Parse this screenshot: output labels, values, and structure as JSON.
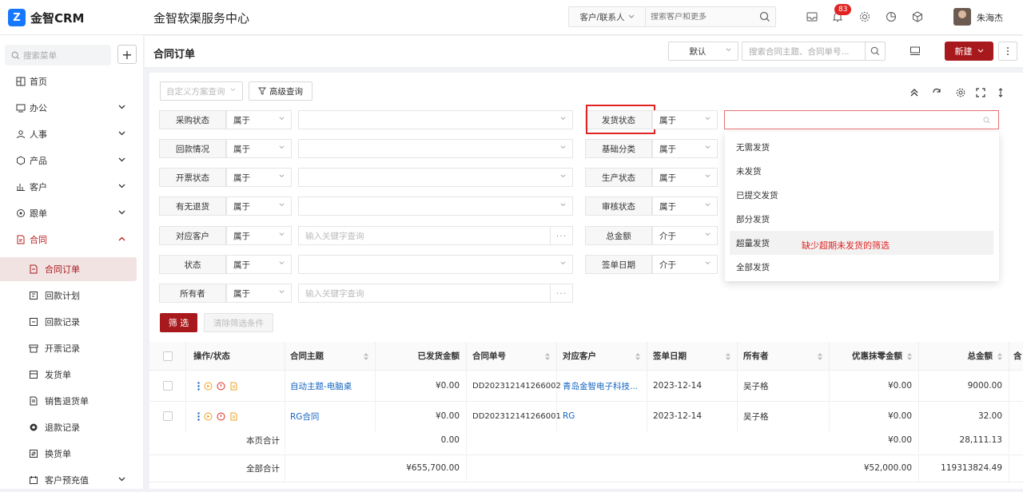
{
  "app": {
    "logo_letter": "Z",
    "name": "金智CRM",
    "page_heading": "金智软渠服务中心",
    "accent": "#a8191d",
    "brand": "#1677ff"
  },
  "global_search": {
    "type_label": "客户/联系人",
    "placeholder": "搜索客户和更多"
  },
  "topbar": {
    "notification_count": "83",
    "user_name": "朱海杰"
  },
  "sidebar": {
    "search_placeholder": "搜索菜单",
    "plus": "+",
    "items": [
      {
        "label": "首页",
        "icon": "home-icon"
      },
      {
        "label": "办公",
        "icon": "office-icon"
      },
      {
        "label": "人事",
        "icon": "hr-icon"
      },
      {
        "label": "产品",
        "icon": "product-icon"
      },
      {
        "label": "客户",
        "icon": "customer-icon"
      },
      {
        "label": "跟单",
        "icon": "follow-icon"
      },
      {
        "label": "合同",
        "icon": "contract-icon"
      }
    ],
    "sub_items": [
      {
        "label": "合同订单",
        "icon": "order-icon"
      },
      {
        "label": "回款计划",
        "icon": "plan-icon"
      },
      {
        "label": "回款记录",
        "icon": "record-icon"
      },
      {
        "label": "开票记录",
        "icon": "invoice-icon"
      },
      {
        "label": "发货单",
        "icon": "delivery-icon"
      },
      {
        "label": "销售退货单",
        "icon": "return-icon"
      },
      {
        "label": "退款记录",
        "icon": "refund-icon"
      },
      {
        "label": "换货单",
        "icon": "exchange-icon"
      },
      {
        "label": "客户预充值",
        "icon": "recharge-icon"
      }
    ]
  },
  "subheader": {
    "title": "合同订单",
    "view_select": "默认",
    "search_placeholder": "搜索合同主题、合同单号...",
    "new_button": "新建"
  },
  "filter": {
    "scheme_placeholder": "自定义方案查询",
    "advanced": "高级查询",
    "left_rows": [
      {
        "label": "采购状态",
        "op": "属于",
        "value": "",
        "type": "select"
      },
      {
        "label": "回款情况",
        "op": "属于",
        "value": "",
        "type": "select"
      },
      {
        "label": "开票状态",
        "op": "属于",
        "value": "",
        "type": "select"
      },
      {
        "label": "有无退货",
        "op": "属于",
        "value": "",
        "type": "select"
      },
      {
        "label": "对应客户",
        "op": "属于",
        "value": "输入关键字查询",
        "type": "lookup"
      },
      {
        "label": "状态",
        "op": "属于",
        "value": "",
        "type": "select"
      },
      {
        "label": "所有者",
        "op": "属于",
        "value": "输入关键字查询",
        "type": "lookup"
      }
    ],
    "right_rows": [
      {
        "label": "发货状态",
        "op": "属于"
      },
      {
        "label": "基础分类",
        "op": "属于"
      },
      {
        "label": "生产状态",
        "op": "属于"
      },
      {
        "label": "审核状态",
        "op": "属于"
      },
      {
        "label": "总金额",
        "op": "介于"
      },
      {
        "label": "签单日期",
        "op": "介于"
      }
    ],
    "ship_status_value": "",
    "ship_options": [
      "无需发货",
      "未发货",
      "已提交发货",
      "部分发货",
      "超量发货",
      "全部发货"
    ],
    "annotation": "缺少超期未发货的筛选",
    "filter_button": "筛 选",
    "clear_button": "清除筛选条件"
  },
  "table": {
    "headers": [
      "操作/状态",
      "合同主题",
      "已发货金额",
      "合同单号",
      "对应客户",
      "签单日期",
      "所有者",
      "优惠抹零金额",
      "总金额",
      "含"
    ],
    "rows": [
      {
        "subject": "自动主题-电脑桌",
        "shipped": "¥0.00",
        "number": "DD202312141266002",
        "customer": "青岛金智电子科技...",
        "date": "2023-12-14",
        "owner": "吴子格",
        "discount": "¥0.00",
        "total": "9000.00"
      },
      {
        "subject": "RG合同",
        "shipped": "¥0.00",
        "number": "DD202312141266001",
        "customer": "RG",
        "date": "2023-12-14",
        "owner": "吴子格",
        "discount": "¥0.00",
        "total": "32.00"
      }
    ],
    "page_total": {
      "label": "本页合计",
      "shipped": "0.00",
      "discount": "¥0.00",
      "total": "28,111.13"
    },
    "all_total": {
      "label": "全部合计",
      "shipped": "¥655,700.00",
      "discount": "¥52,000.00",
      "total": "119313824.49"
    }
  }
}
